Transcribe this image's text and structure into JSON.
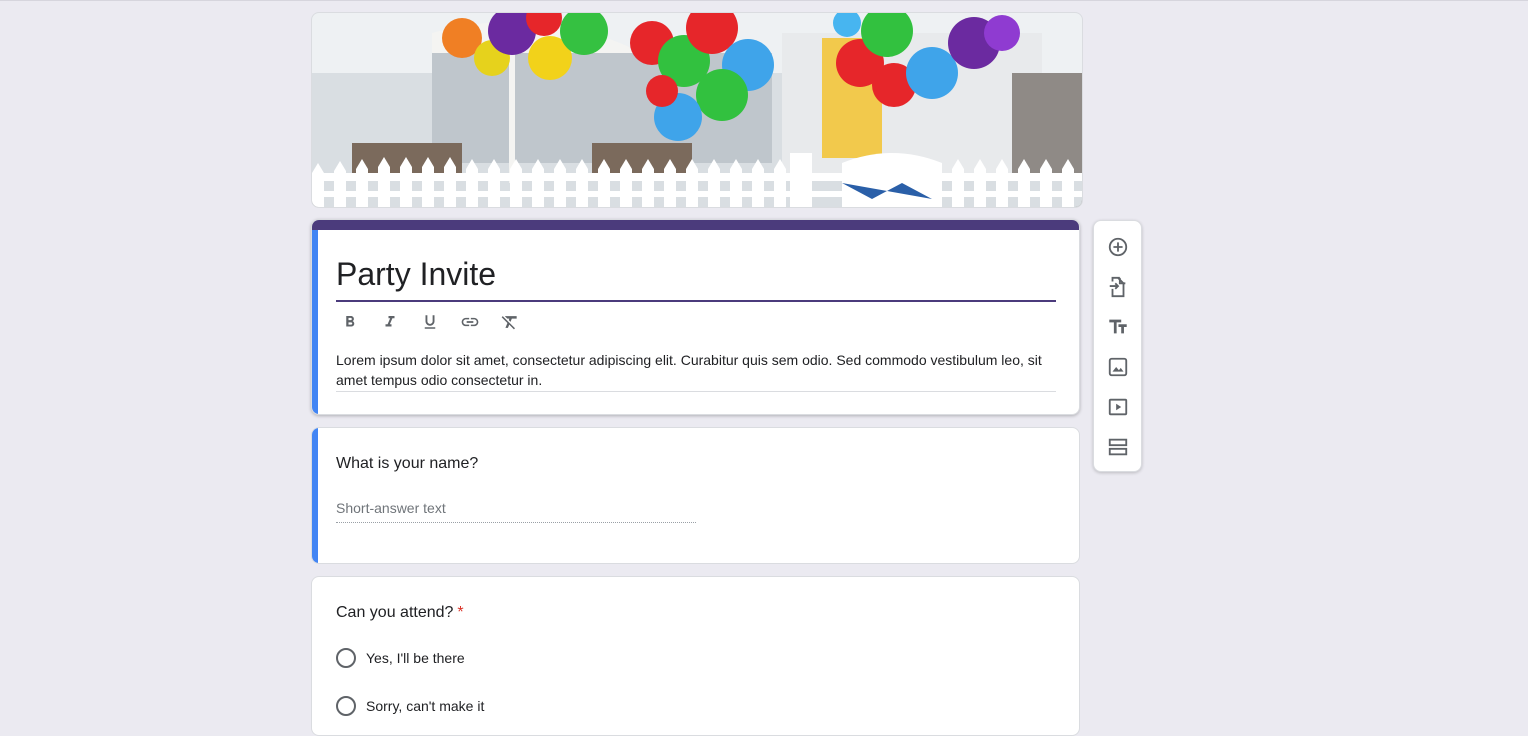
{
  "form": {
    "title": "Party Invite",
    "description": "Lorem ipsum dolor sit amet, consectetur adipiscing elit. Curabitur quis sem odio. Sed commodo vestibulum leo, sit amet tempus odio consectetur in.",
    "header_image": "balloons-house-banner",
    "theme_color": "#4b3b7c",
    "active_accent": "#4285f4"
  },
  "formatting_toolbar": [
    {
      "icon": "bold-icon"
    },
    {
      "icon": "italic-icon"
    },
    {
      "icon": "underline-icon"
    },
    {
      "icon": "link-icon"
    },
    {
      "icon": "clear-formatting-icon"
    }
  ],
  "questions": [
    {
      "title": "What is your name?",
      "type": "short-answer",
      "placeholder": "Short-answer text",
      "required": false
    },
    {
      "title": "Can you attend?",
      "type": "multiple-choice",
      "required": true,
      "required_mark": "*",
      "options": [
        "Yes,  I'll be there",
        "Sorry, can't make it"
      ]
    }
  ],
  "side_toolbar": [
    {
      "icon": "add-question-icon"
    },
    {
      "icon": "import-questions-icon"
    },
    {
      "icon": "add-title-icon"
    },
    {
      "icon": "add-image-icon"
    },
    {
      "icon": "add-video-icon"
    },
    {
      "icon": "add-section-icon"
    }
  ]
}
